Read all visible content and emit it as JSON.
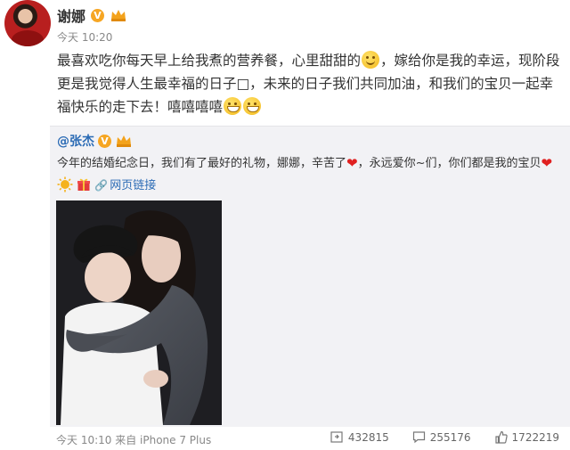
{
  "post": {
    "author": "谢娜",
    "verified_badge": "V",
    "time": "今天 10:20",
    "text_parts": [
      "最喜欢吃你每天早上给我煮的营养餐，心里甜甜的",
      "，嫁给你是我的幸运，现阶段更是我觉得人生最幸福的日子",
      "，未来的日子我们共同加油，和我们的宝贝一起幸福快乐的走下去！嘻嘻嘻嘻"
    ],
    "box_glyph": "□"
  },
  "repost": {
    "author": "@张杰",
    "verified_badge": "V",
    "text_part1": "今年的结婚纪念日，我们有了最好的礼物，娜娜，辛苦了",
    "text_part2": "，永远爱你~们，你们都是我的宝贝",
    "link_text": "网页链接"
  },
  "footer": {
    "time_source": "今天 10:10 来自 iPhone 7 Plus",
    "reposts": "432815",
    "comments": "255176",
    "likes": "1722219"
  },
  "colors": {
    "link": "#2b6bb5",
    "repost_bg": "#f2f2f5",
    "badge": "#f6a623",
    "heart": "#e02020"
  }
}
